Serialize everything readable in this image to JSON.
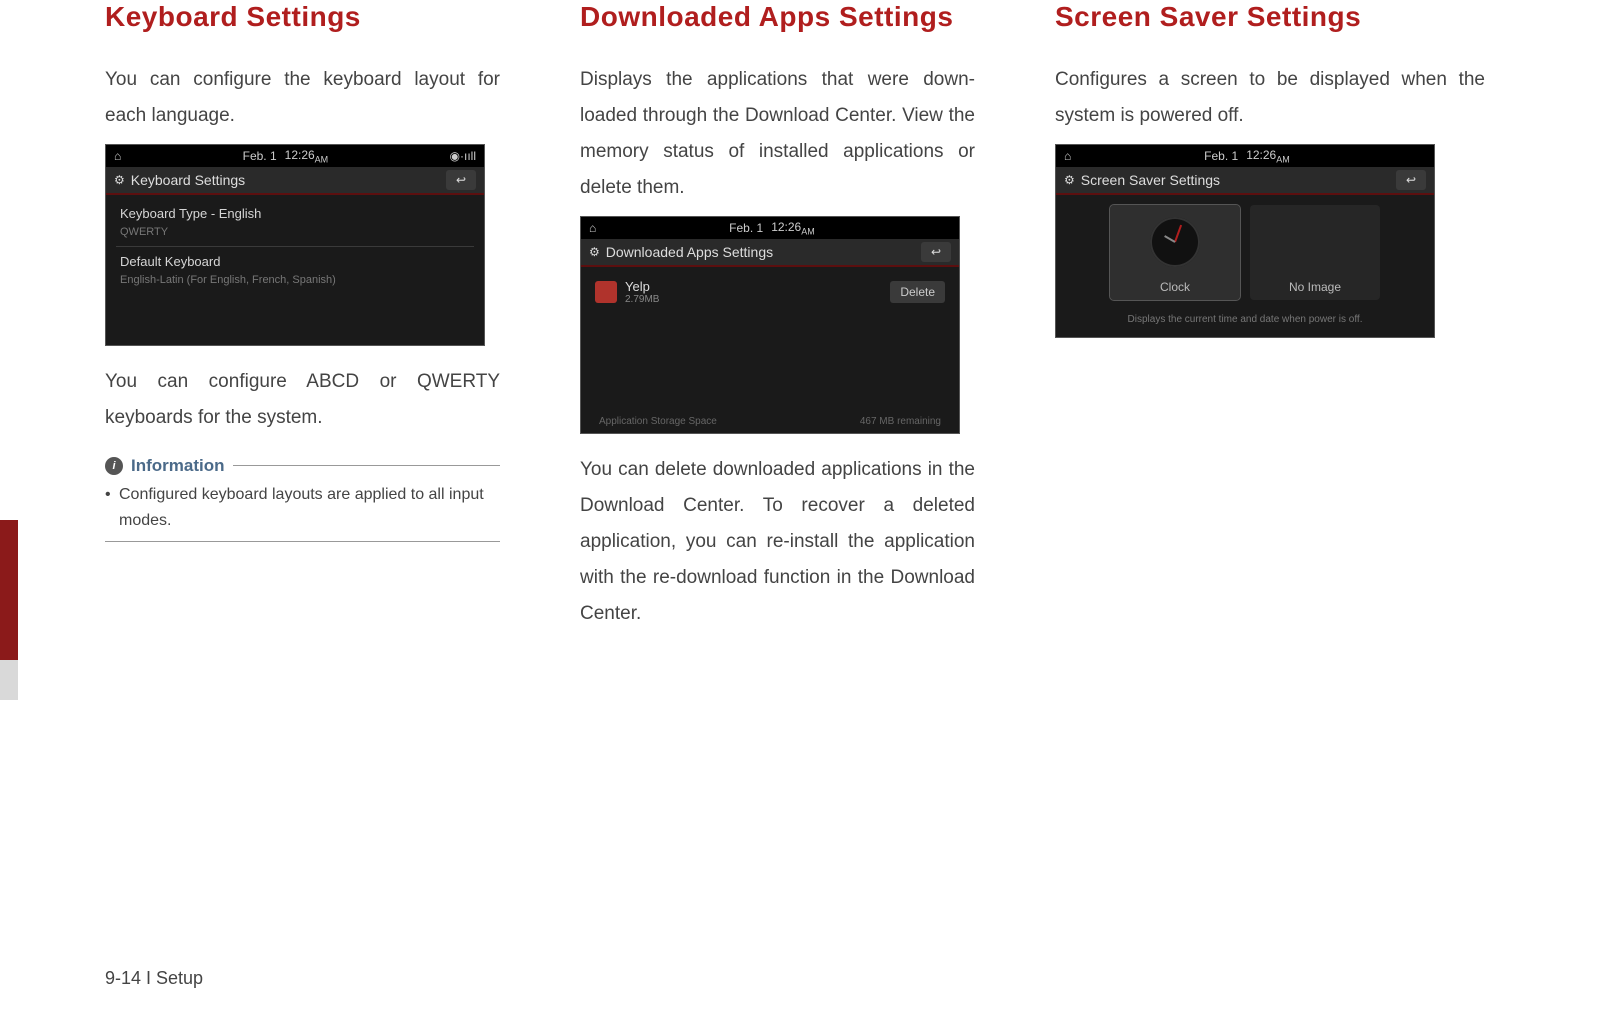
{
  "page_footer": "9-14 I Setup",
  "shared": {
    "date": "Feb.  1",
    "time": "12:26",
    "ampm": "AM",
    "back_glyph": "↩"
  },
  "col1": {
    "heading": "Keyboard Settings",
    "intro": "You can configure the keyboard layout for each language.",
    "screenshot": {
      "title": "Keyboard Settings",
      "row1": "Keyboard Type - English",
      "row1_sub": "QWERTY",
      "row2": "Default Keyboard",
      "row2_sub": "English-Latin (For English, French, Spanish)"
    },
    "para2": "You can configure ABCD or QWERTY keyboards for the system.",
    "info_label": "Information",
    "info_bullet": "Configured keyboard layouts are applied to all input modes."
  },
  "col2": {
    "heading": "Downloaded Apps Settings",
    "intro": "Displays the applications that were down­loaded through the Download Center. View the memory status of installed applications or delete them.",
    "screenshot": {
      "title": "Downloaded Apps Settings",
      "app_name": "Yelp",
      "app_size": "2.79MB",
      "delete": "Delete",
      "footer_left": "Application Storage Space",
      "footer_right": "467 MB remaining"
    },
    "para2": "You can delete downloaded applications in the Download Center. To recover a deleted application, you can re-install the applica­tion with the re-download function in the Download Center."
  },
  "col3": {
    "heading": "Screen Saver Settings",
    "intro": "Configures a screen to be displayed when the system is powered off.",
    "screenshot": {
      "title": "Screen Saver Settings",
      "opt1": "Clock",
      "opt2": "No Image",
      "hint": "Displays the current time and date when power is off."
    }
  }
}
